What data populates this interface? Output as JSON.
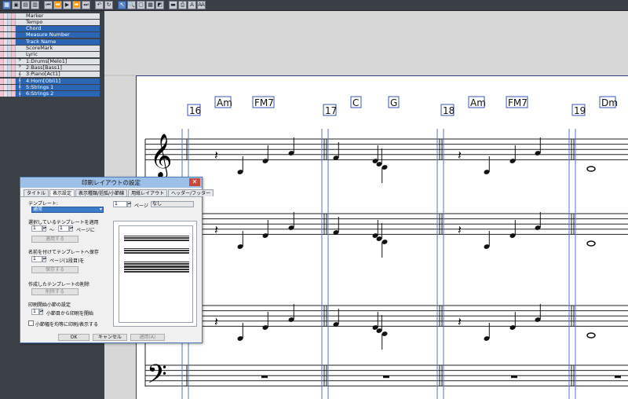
{
  "toolbar": {
    "buttons": [
      {
        "icon": "score-view-icon",
        "glyph": "▦",
        "active": true
      },
      {
        "icon": "select-icon",
        "glyph": "▣",
        "active": false
      },
      {
        "icon": "piano-roll-icon",
        "glyph": "▤",
        "active": false
      },
      {
        "icon": "staff-icon",
        "glyph": "▥",
        "active": false
      },
      {
        "icon": "go-start-icon",
        "glyph": "⏮",
        "active": false
      },
      {
        "icon": "rewind-icon",
        "glyph": "⏪",
        "active": false
      },
      {
        "icon": "play-icon",
        "glyph": "▶",
        "active": false
      },
      {
        "icon": "forward-icon",
        "glyph": "⏩",
        "active": false
      },
      {
        "icon": "go-end-icon",
        "glyph": "⏭",
        "active": false
      },
      {
        "icon": "undo-icon",
        "glyph": "↶",
        "active": false
      },
      {
        "icon": "loop-icon",
        "glyph": "↻",
        "active": false
      },
      {
        "icon": "pointer-icon",
        "glyph": "↖",
        "active": true
      },
      {
        "icon": "zoom-icon",
        "glyph": "🔍",
        "active": false
      },
      {
        "icon": "page-icon",
        "glyph": "▢",
        "active": false
      },
      {
        "icon": "grid-icon",
        "glyph": "▦",
        "active": false
      },
      {
        "icon": "eraser-icon",
        "glyph": "◩",
        "active": false
      },
      {
        "icon": "mixer-icon",
        "glyph": "▬",
        "active": false
      },
      {
        "icon": "print-icon",
        "glyph": "⎙",
        "active": false
      },
      {
        "icon": "text-icon",
        "glyph": "A",
        "active": false
      },
      {
        "icon": "font-icon",
        "glyph": "Ꜳ",
        "active": false
      }
    ]
  },
  "tracks": [
    {
      "label": "Marker",
      "selected": false,
      "clef": ""
    },
    {
      "label": "Tempo",
      "selected": false,
      "clef": ""
    },
    {
      "label": "Chord",
      "selected": true,
      "clef": ""
    },
    {
      "label": "Measure Number",
      "selected": true,
      "clef": ""
    },
    {
      "label": "Track Name",
      "selected": true,
      "clef": ""
    },
    {
      "label": "ScoreMark",
      "selected": false,
      "clef": ""
    },
    {
      "label": "Lyric",
      "selected": false,
      "clef": ""
    },
    {
      "label": "1:Drums[Melo1]",
      "selected": false,
      "clef": "𝄢"
    },
    {
      "label": "2:Bass[Bass1]",
      "selected": false,
      "clef": "𝄢"
    },
    {
      "label": "3:Piano[Act1]",
      "selected": false,
      "clef": "𝄞"
    },
    {
      "label": "4:Horn[Obli1]",
      "selected": true,
      "clef": "𝄞"
    },
    {
      "label": "5:Strings 1",
      "selected": true,
      "clef": "𝄞"
    },
    {
      "label": "6:Strings 2",
      "selected": true,
      "clef": "𝄞"
    }
  ],
  "score": {
    "measures": [
      {
        "number": "16",
        "chords": [
          "Am",
          "FM7"
        ]
      },
      {
        "number": "17",
        "chords": [
          "C",
          "G"
        ]
      },
      {
        "number": "18",
        "chords": [
          "Am",
          "FM7"
        ]
      },
      {
        "number": "19",
        "chords": [
          "Dm"
        ]
      }
    ]
  },
  "dialog": {
    "title": "印刷レイアウトの設定",
    "tabs": [
      "タイトル",
      "表示設定",
      "表示種類/括弧/小節線",
      "用紙レイアウト",
      "ヘッダー/フッター"
    ],
    "active_tab": 1,
    "template_label": "テンプレート:",
    "template_value": "通常",
    "page_value": "1",
    "page_label": "ページ",
    "page_name": "なし",
    "apply_group": "選択しているテンプレートを適用",
    "apply_from": "1",
    "apply_tilde": "〜",
    "apply_to": "1",
    "apply_suffix": "ページに",
    "apply_button": "適用する",
    "save_group": "名前を付けてテンプレートへ保存",
    "save_page": "1",
    "save_suffix": "ページ(1段目)を",
    "save_button": "保存する",
    "delete_group": "作成したテンプレートの削除",
    "delete_button": "削除する",
    "start_group": "印刷開始小節の設定",
    "start_value": "1",
    "start_suffix": "小節目から印刷を開始",
    "equal_width_label": "小節幅を均等に印刷/表示する",
    "ok": "OK",
    "cancel": "キャンセル",
    "apply": "適用(A)"
  }
}
